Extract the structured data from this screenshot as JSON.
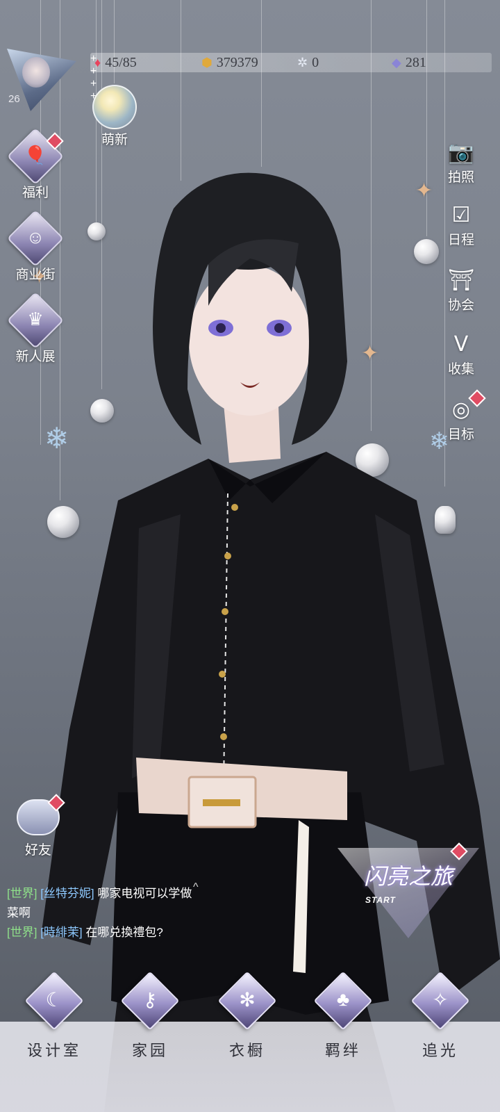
{
  "resources": {
    "stamina": {
      "icon": "heart-gem-icon",
      "value": "45/85",
      "color": "#e8445d"
    },
    "gold": {
      "icon": "gold-coin-icon",
      "value": "379379",
      "color": "#e0a93b"
    },
    "crystal": {
      "icon": "crystal-icon",
      "value": "0",
      "color": "#b7c3d8"
    },
    "diamond": {
      "icon": "diamond-icon",
      "value": "281",
      "color": "#8a84d6"
    }
  },
  "player": {
    "level": "26"
  },
  "top_left": {
    "newbie_label": "萌新"
  },
  "left_menu": [
    {
      "id": "welfare",
      "label": "福利",
      "icon": "balloon-icon",
      "badge": true
    },
    {
      "id": "shopping-street",
      "label": "商业街",
      "icon": "shopping-bag-icon",
      "badge": false
    },
    {
      "id": "newcomer-exhibit",
      "label": "新人展",
      "icon": "crown-icon",
      "badge": false
    }
  ],
  "right_menu": [
    {
      "id": "photo",
      "label": "拍照",
      "icon": "camera-icon"
    },
    {
      "id": "schedule",
      "label": "日程",
      "icon": "calendar-icon"
    },
    {
      "id": "guild",
      "label": "协会",
      "icon": "building-icon"
    },
    {
      "id": "collection",
      "label": "收集",
      "icon": "v-card-icon"
    },
    {
      "id": "goals",
      "label": "目标",
      "icon": "target-icon",
      "badge": true
    }
  ],
  "friends": {
    "label": "好友",
    "icon": "friends-bubble-icon"
  },
  "chat": {
    "messages": [
      {
        "channel": "[世界]",
        "sender": "[丝特芬妮]",
        "text": "哪家电视可以学做菜啊"
      },
      {
        "channel": "[世界]",
        "sender": "[時緋茉]",
        "text": "在哪兑換禮包?"
      }
    ],
    "toggle": "^"
  },
  "event_banner": {
    "title": "闪亮之旅",
    "subtitle": "START"
  },
  "bottom_nav": [
    {
      "id": "design-room",
      "label": "设计室",
      "icon": "moon-icon"
    },
    {
      "id": "home",
      "label": "家园",
      "icon": "key-icon"
    },
    {
      "id": "wardrobe",
      "label": "衣橱",
      "icon": "snowflake-icon"
    },
    {
      "id": "bonds",
      "label": "羁绊",
      "icon": "clover-icon"
    },
    {
      "id": "chase-light",
      "label": "追光",
      "icon": "butterfly-icon"
    }
  ]
}
